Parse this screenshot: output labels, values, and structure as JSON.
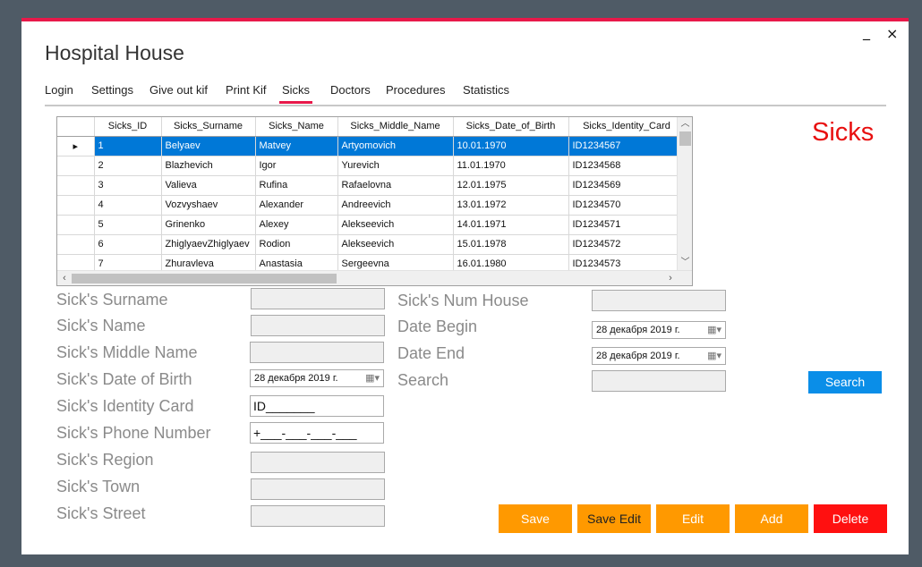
{
  "window": {
    "title": "Hospital House",
    "minimize_glyph": "_",
    "close_glyph": "×"
  },
  "tabs": [
    {
      "label": "Login"
    },
    {
      "label": "Settings"
    },
    {
      "label": "Give out kif"
    },
    {
      "label": "Print Kif"
    },
    {
      "label": "Sicks",
      "active": true
    },
    {
      "label": "Doctors"
    },
    {
      "label": "Procedures"
    },
    {
      "label": "Statistics"
    }
  ],
  "section_heading": "Sicks",
  "grid": {
    "columns": [
      "Sicks_ID",
      "Sicks_Surname",
      "Sicks_Name",
      "Sicks_Middle_Name",
      "Sicks_Date_of_Birth",
      "Sicks_Identity_Card"
    ],
    "current_row_marker": "▸",
    "rows": [
      [
        "1",
        "Belyaev",
        "Matvey",
        "Artyomovich",
        "10.01.1970",
        "ID1234567"
      ],
      [
        "2",
        "Blazhevich",
        "Igor",
        "Yurevich",
        "11.01.1970",
        "ID1234568"
      ],
      [
        "3",
        "Valieva",
        "Rufina",
        "Rafaelovna",
        "12.01.1975",
        "ID1234569"
      ],
      [
        "4",
        "Vozvyshaev",
        "Alexander",
        "Andreevich",
        "13.01.1972",
        "ID1234570"
      ],
      [
        "5",
        "Grinenko",
        "Alexey",
        "Alekseevich",
        "14.01.1971",
        "ID1234571"
      ],
      [
        "6",
        "ZhiglyaevZhiglyaev",
        "Rodion",
        "Alekseevich",
        "15.01.1978",
        "ID1234572"
      ],
      [
        "7",
        "Zhuravleva",
        "Anastasia",
        "Sergeevna",
        "16.01.1980",
        "ID1234573"
      ]
    ],
    "selected_row": 0
  },
  "form": {
    "surname_label": "Sick's Surname",
    "name_label": "Sick's Name",
    "middle_name_label": "Sick's Middle Name",
    "dob_label": "Sick's Date of Birth",
    "dob_value": "28 декабря  2019 г.",
    "identity_card_label": "Sick's Identity Card",
    "identity_card_value": "ID_______",
    "phone_label": "Sick's Phone Number",
    "phone_value": "+___-___-___-___",
    "region_label": "Sick's Region",
    "town_label": "Sick's Town",
    "street_label": "Sick's Street",
    "num_house_label": "Sick's Num House",
    "date_begin_label": "Date Begin",
    "date_begin_value": "28 декабря  2019 г.",
    "date_end_label": "Date End",
    "date_end_value": "28 декабря  2019 г.",
    "search_label": "Search",
    "search_button": "Search"
  },
  "actions": {
    "save": "Save",
    "save_edit": "Save Edit",
    "edit": "Edit",
    "add": "Add",
    "delete": "Delete"
  },
  "colors": {
    "accent": "#e8194a",
    "heading_red": "#e81010",
    "orange_button": "#ff9900",
    "delete_button": "#ff1010",
    "search_button": "#0a8ee8",
    "selection": "#0078d7"
  }
}
